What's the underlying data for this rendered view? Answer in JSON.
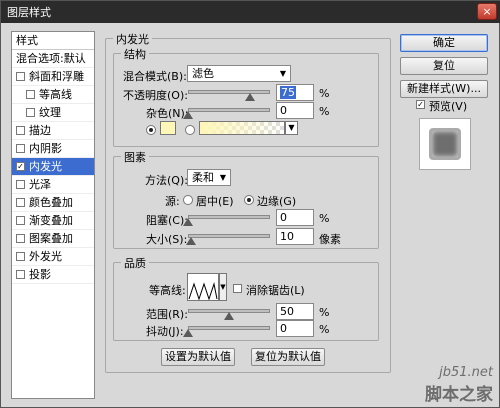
{
  "window": {
    "title": "图层样式",
    "close_symbol": "×"
  },
  "styles_list": {
    "header": "样式",
    "items": [
      {
        "label": "混合选项:默认",
        "checkbox": false,
        "checked": false,
        "indent": false,
        "selected": false
      },
      {
        "label": "斜面和浮雕",
        "checkbox": true,
        "checked": false,
        "indent": false,
        "selected": false
      },
      {
        "label": "等高线",
        "checkbox": true,
        "checked": false,
        "indent": true,
        "selected": false
      },
      {
        "label": "纹理",
        "checkbox": true,
        "checked": false,
        "indent": true,
        "selected": false
      },
      {
        "label": "描边",
        "checkbox": true,
        "checked": false,
        "indent": false,
        "selected": false
      },
      {
        "label": "内阴影",
        "checkbox": true,
        "checked": false,
        "indent": false,
        "selected": false
      },
      {
        "label": "内发光",
        "checkbox": true,
        "checked": true,
        "indent": false,
        "selected": true
      },
      {
        "label": "光泽",
        "checkbox": true,
        "checked": false,
        "indent": false,
        "selected": false
      },
      {
        "label": "颜色叠加",
        "checkbox": true,
        "checked": false,
        "indent": false,
        "selected": false
      },
      {
        "label": "渐变叠加",
        "checkbox": true,
        "checked": false,
        "indent": false,
        "selected": false
      },
      {
        "label": "图案叠加",
        "checkbox": true,
        "checked": false,
        "indent": false,
        "selected": false
      },
      {
        "label": "外发光",
        "checkbox": true,
        "checked": false,
        "indent": false,
        "selected": false
      },
      {
        "label": "投影",
        "checkbox": true,
        "checked": false,
        "indent": false,
        "selected": false
      }
    ]
  },
  "inner_glow": {
    "title": "内发光",
    "structure": {
      "legend": "结构",
      "blend_mode_label": "混合模式(B):",
      "blend_mode_value": "滤色",
      "opacity_label": "不透明度(O):",
      "opacity_value": "75",
      "opacity_fraction": 0.75,
      "noise_label": "杂色(N):",
      "noise_value": "0",
      "noise_fraction": 0,
      "percent": "%"
    },
    "elements": {
      "legend": "图素",
      "method_label": "方法(Q):",
      "method_value": "柔和",
      "source_label": "源:",
      "source_center": "居中(E)",
      "source_edge": "边缘(G)",
      "choke_label": "阻塞(C):",
      "choke_value": "0",
      "choke_fraction": 0,
      "size_label": "大小(S):",
      "size_value": "10",
      "size_fraction": 0.04,
      "percent": "%",
      "pixels": "像素"
    },
    "quality": {
      "legend": "品质",
      "contour_label": "等高线:",
      "antialias_label": "消除锯齿(L)",
      "range_label": "范围(R):",
      "range_value": "50",
      "range_fraction": 0.5,
      "jitter_label": "抖动(J):",
      "jitter_value": "0",
      "jitter_fraction": 0,
      "percent": "%"
    },
    "set_default_button": "设置为默认值",
    "reset_default_button": "复位为默认值"
  },
  "colors": {
    "glow_color": "#fff7b8",
    "selection": "#3c6ccf"
  },
  "buttons": {
    "ok": "确定",
    "reset": "复位",
    "new_style": "新建样式(W)...",
    "preview_label": "预览(V)",
    "preview_checked": true
  },
  "watermark": {
    "line1": "jb51.net",
    "line2": "脚本之家"
  }
}
